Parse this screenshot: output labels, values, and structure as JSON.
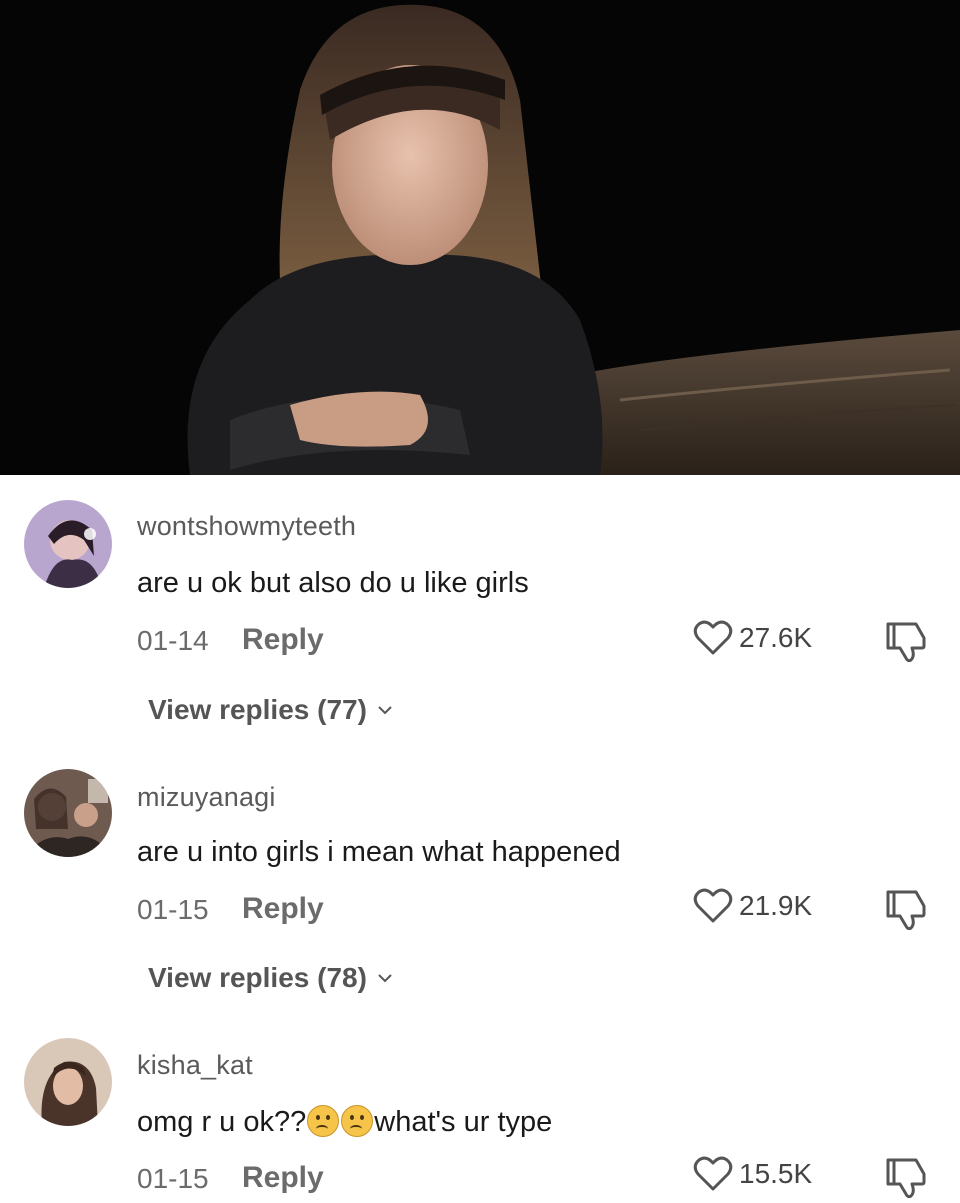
{
  "comments": [
    {
      "username": "wontshowmyteeth",
      "text": "are u ok but also do u like girls",
      "date": "01-14",
      "reply_label": "Reply",
      "likes": "27.6K",
      "view_replies": "View replies (77)"
    },
    {
      "username": "mizuyanagi",
      "text": "are u into girls i mean what happened",
      "date": "01-15",
      "reply_label": "Reply",
      "likes": "21.9K",
      "view_replies": "View replies (78)"
    },
    {
      "username": "kisha_kat",
      "text_before": "omg r u ok??",
      "text_after": "what's ur type",
      "emojis": [
        "frowning-face-emoji",
        "frowning-face-emoji"
      ],
      "date": "01-15",
      "reply_label": "Reply",
      "likes": "15.5K"
    }
  ],
  "icons": {
    "like": "heart-outline-icon",
    "dislike": "thumbs-down-icon",
    "expand": "chevron-down-icon"
  },
  "colors": {
    "background": "#ffffff",
    "photo_background": "#050505",
    "text_primary": "#1a1a1a",
    "text_secondary": "#6b6b6b"
  }
}
